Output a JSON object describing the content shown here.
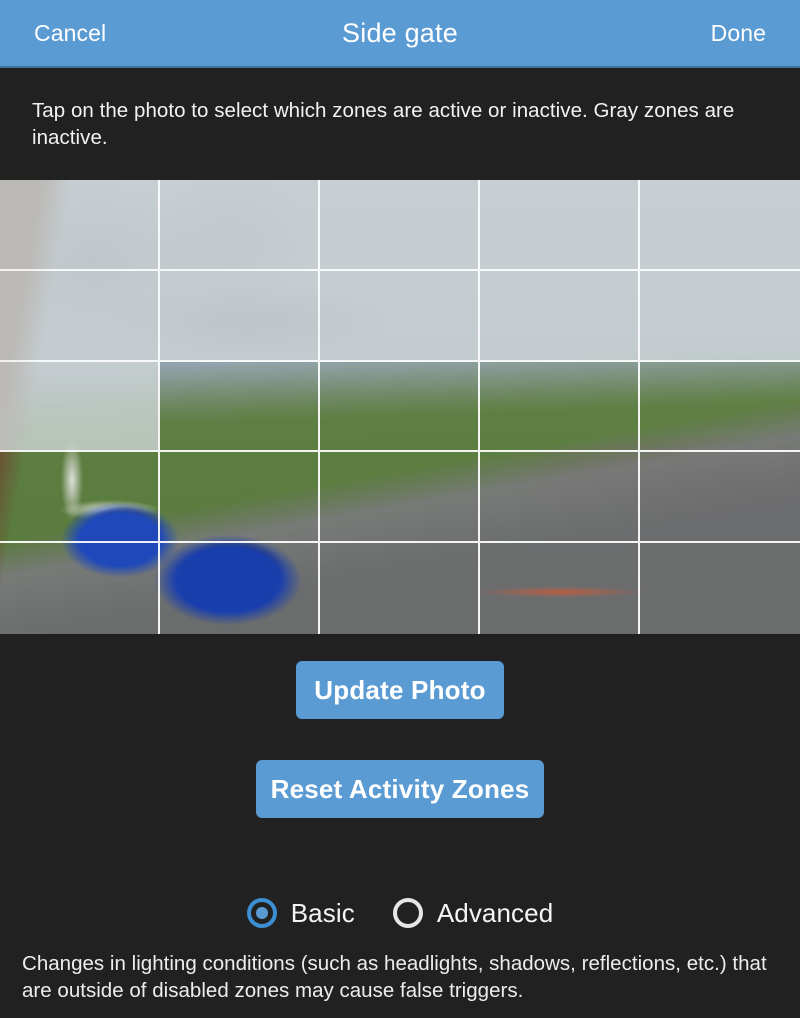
{
  "header": {
    "cancel_label": "Cancel",
    "title": "Side gate",
    "done_label": "Done",
    "background_color": "#5a9bd4"
  },
  "instruction": {
    "text": "Tap on the photo to select which zones are active or inactive. Gray zones are inactive."
  },
  "photo": {
    "grid_columns": 5,
    "grid_rows": 5,
    "grid_line_color": "#ffffff",
    "inactive_overlay_color": "#d0d6d8",
    "zones": [
      {
        "row": 1,
        "col": 1,
        "state": "inactive"
      },
      {
        "row": 1,
        "col": 2,
        "state": "inactive"
      },
      {
        "row": 1,
        "col": 3,
        "state": "inactive"
      },
      {
        "row": 1,
        "col": 4,
        "state": "inactive"
      },
      {
        "row": 1,
        "col": 5,
        "state": "inactive"
      },
      {
        "row": 2,
        "col": 1,
        "state": "inactive"
      },
      {
        "row": 2,
        "col": 2,
        "state": "inactive"
      },
      {
        "row": 2,
        "col": 3,
        "state": "inactive"
      },
      {
        "row": 2,
        "col": 4,
        "state": "inactive"
      },
      {
        "row": 2,
        "col": 5,
        "state": "inactive"
      },
      {
        "row": 3,
        "col": 1,
        "state": "inactive"
      },
      {
        "row": 3,
        "col": 2,
        "state": "active"
      },
      {
        "row": 3,
        "col": 3,
        "state": "active"
      },
      {
        "row": 3,
        "col": 4,
        "state": "active"
      },
      {
        "row": 3,
        "col": 5,
        "state": "active"
      },
      {
        "row": 4,
        "col": 1,
        "state": "active"
      },
      {
        "row": 4,
        "col": 2,
        "state": "active"
      },
      {
        "row": 4,
        "col": 3,
        "state": "active"
      },
      {
        "row": 4,
        "col": 4,
        "state": "active"
      },
      {
        "row": 4,
        "col": 5,
        "state": "active"
      },
      {
        "row": 5,
        "col": 1,
        "state": "active"
      },
      {
        "row": 5,
        "col": 2,
        "state": "active"
      },
      {
        "row": 5,
        "col": 3,
        "state": "active"
      },
      {
        "row": 5,
        "col": 4,
        "state": "active"
      },
      {
        "row": 5,
        "col": 5,
        "state": "active"
      }
    ]
  },
  "actions": {
    "update_photo_label": "Update Photo",
    "reset_zones_label": "Reset Activity Zones",
    "button_color": "#5a9bd4"
  },
  "mode": {
    "selected": "Basic",
    "options": [
      {
        "label": "Basic",
        "selected": true
      },
      {
        "label": "Advanced",
        "selected": false
      }
    ]
  },
  "footer": {
    "text": "Changes in lighting conditions (such as headlights, shadows, reflections, etc.) that are outside of disabled zones may cause false triggers."
  }
}
